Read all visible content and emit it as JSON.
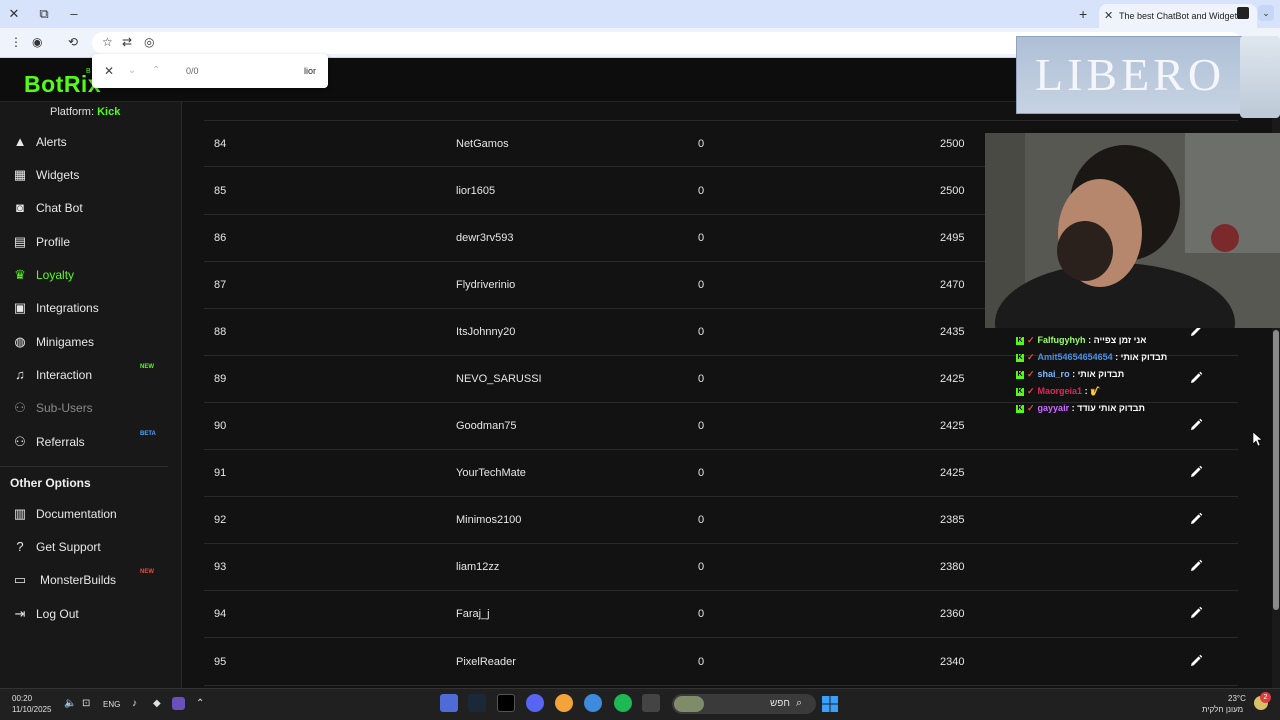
{
  "browser": {
    "tab_title": "The best ChatBot and Widgets",
    "find": {
      "count": "0/0",
      "query": "lior"
    }
  },
  "app": {
    "logo": "BotRix",
    "logo_badge": "B",
    "platform_label": "Platform:",
    "platform_value": "Kick"
  },
  "sidebar": {
    "items": [
      {
        "label": "Alerts",
        "icon": "warning-icon"
      },
      {
        "label": "Widgets",
        "icon": "grid-icon"
      },
      {
        "label": "Chat Bot",
        "icon": "robot-icon"
      },
      {
        "label": "Profile",
        "icon": "id-card-icon"
      },
      {
        "label": "Loyalty",
        "icon": "trophy-icon"
      },
      {
        "label": "Integrations",
        "icon": "plug-icon"
      },
      {
        "label": "Minigames",
        "icon": "gamepad-icon"
      },
      {
        "label": "Interaction",
        "icon": "music-icon",
        "badge": "NEW"
      },
      {
        "label": "Sub-Users",
        "icon": "users-icon"
      },
      {
        "label": "Referrals",
        "icon": "users-icon",
        "badge": "BETA"
      }
    ],
    "other_title": "Other Options",
    "other_items": [
      {
        "label": "Documentation",
        "icon": "book-icon"
      },
      {
        "label": "Get Support",
        "icon": "help-icon"
      },
      {
        "label": "MonsterBuilds",
        "icon": "laptop-icon",
        "badge": "NEW"
      },
      {
        "label": "Log Out",
        "icon": "logout-icon"
      }
    ]
  },
  "table": {
    "rows": [
      {
        "rank": "84",
        "name": "NetGamos",
        "a": "0",
        "b": "2500"
      },
      {
        "rank": "85",
        "name": "lior1605",
        "a": "0",
        "b": "2500"
      },
      {
        "rank": "86",
        "name": "dewr3rv593",
        "a": "0",
        "b": "2495"
      },
      {
        "rank": "87",
        "name": "Flydriverinio",
        "a": "0",
        "b": "2470"
      },
      {
        "rank": "88",
        "name": "ItsJohnny20",
        "a": "0",
        "b": "2435"
      },
      {
        "rank": "89",
        "name": "NEVO_SARUSSI",
        "a": "0",
        "b": "2425"
      },
      {
        "rank": "90",
        "name": "Goodman75",
        "a": "0",
        "b": "2425"
      },
      {
        "rank": "91",
        "name": "YourTechMate",
        "a": "0",
        "b": "2425"
      },
      {
        "rank": "92",
        "name": "Minimos2100",
        "a": "0",
        "b": "2385"
      },
      {
        "rank": "93",
        "name": "liam12zz",
        "a": "0",
        "b": "2380"
      },
      {
        "rank": "94",
        "name": "Faraj_j",
        "a": "0",
        "b": "2360"
      },
      {
        "rank": "95",
        "name": "PixelReader",
        "a": "0",
        "b": "2340"
      }
    ]
  },
  "overlay": {
    "libero": "LIBERO",
    "chat": [
      {
        "user": "Falfugyhyh",
        "color": "#9bff6a",
        "msg": "אני זמן צפייה"
      },
      {
        "user": "Amit54654654654",
        "color": "#4a90e2",
        "msg": "תבדוק אותי"
      },
      {
        "user": "shai_ro",
        "color": "#7fb8ff",
        "msg": "תבדוק אותי"
      },
      {
        "user": "Maorgeia1",
        "color": "#e0245e",
        "msg": "🎷"
      },
      {
        "user": "gayyair",
        "color": "#c86bff",
        "msg": "תבדוק אותי עודד"
      }
    ]
  },
  "taskbar": {
    "time": "00:20",
    "date": "11/10/2025",
    "lang": "ENG",
    "search_placeholder": "חפש",
    "weather_temp": "23°C",
    "weather_desc": "מעונן חלקית",
    "notifications": "2"
  }
}
